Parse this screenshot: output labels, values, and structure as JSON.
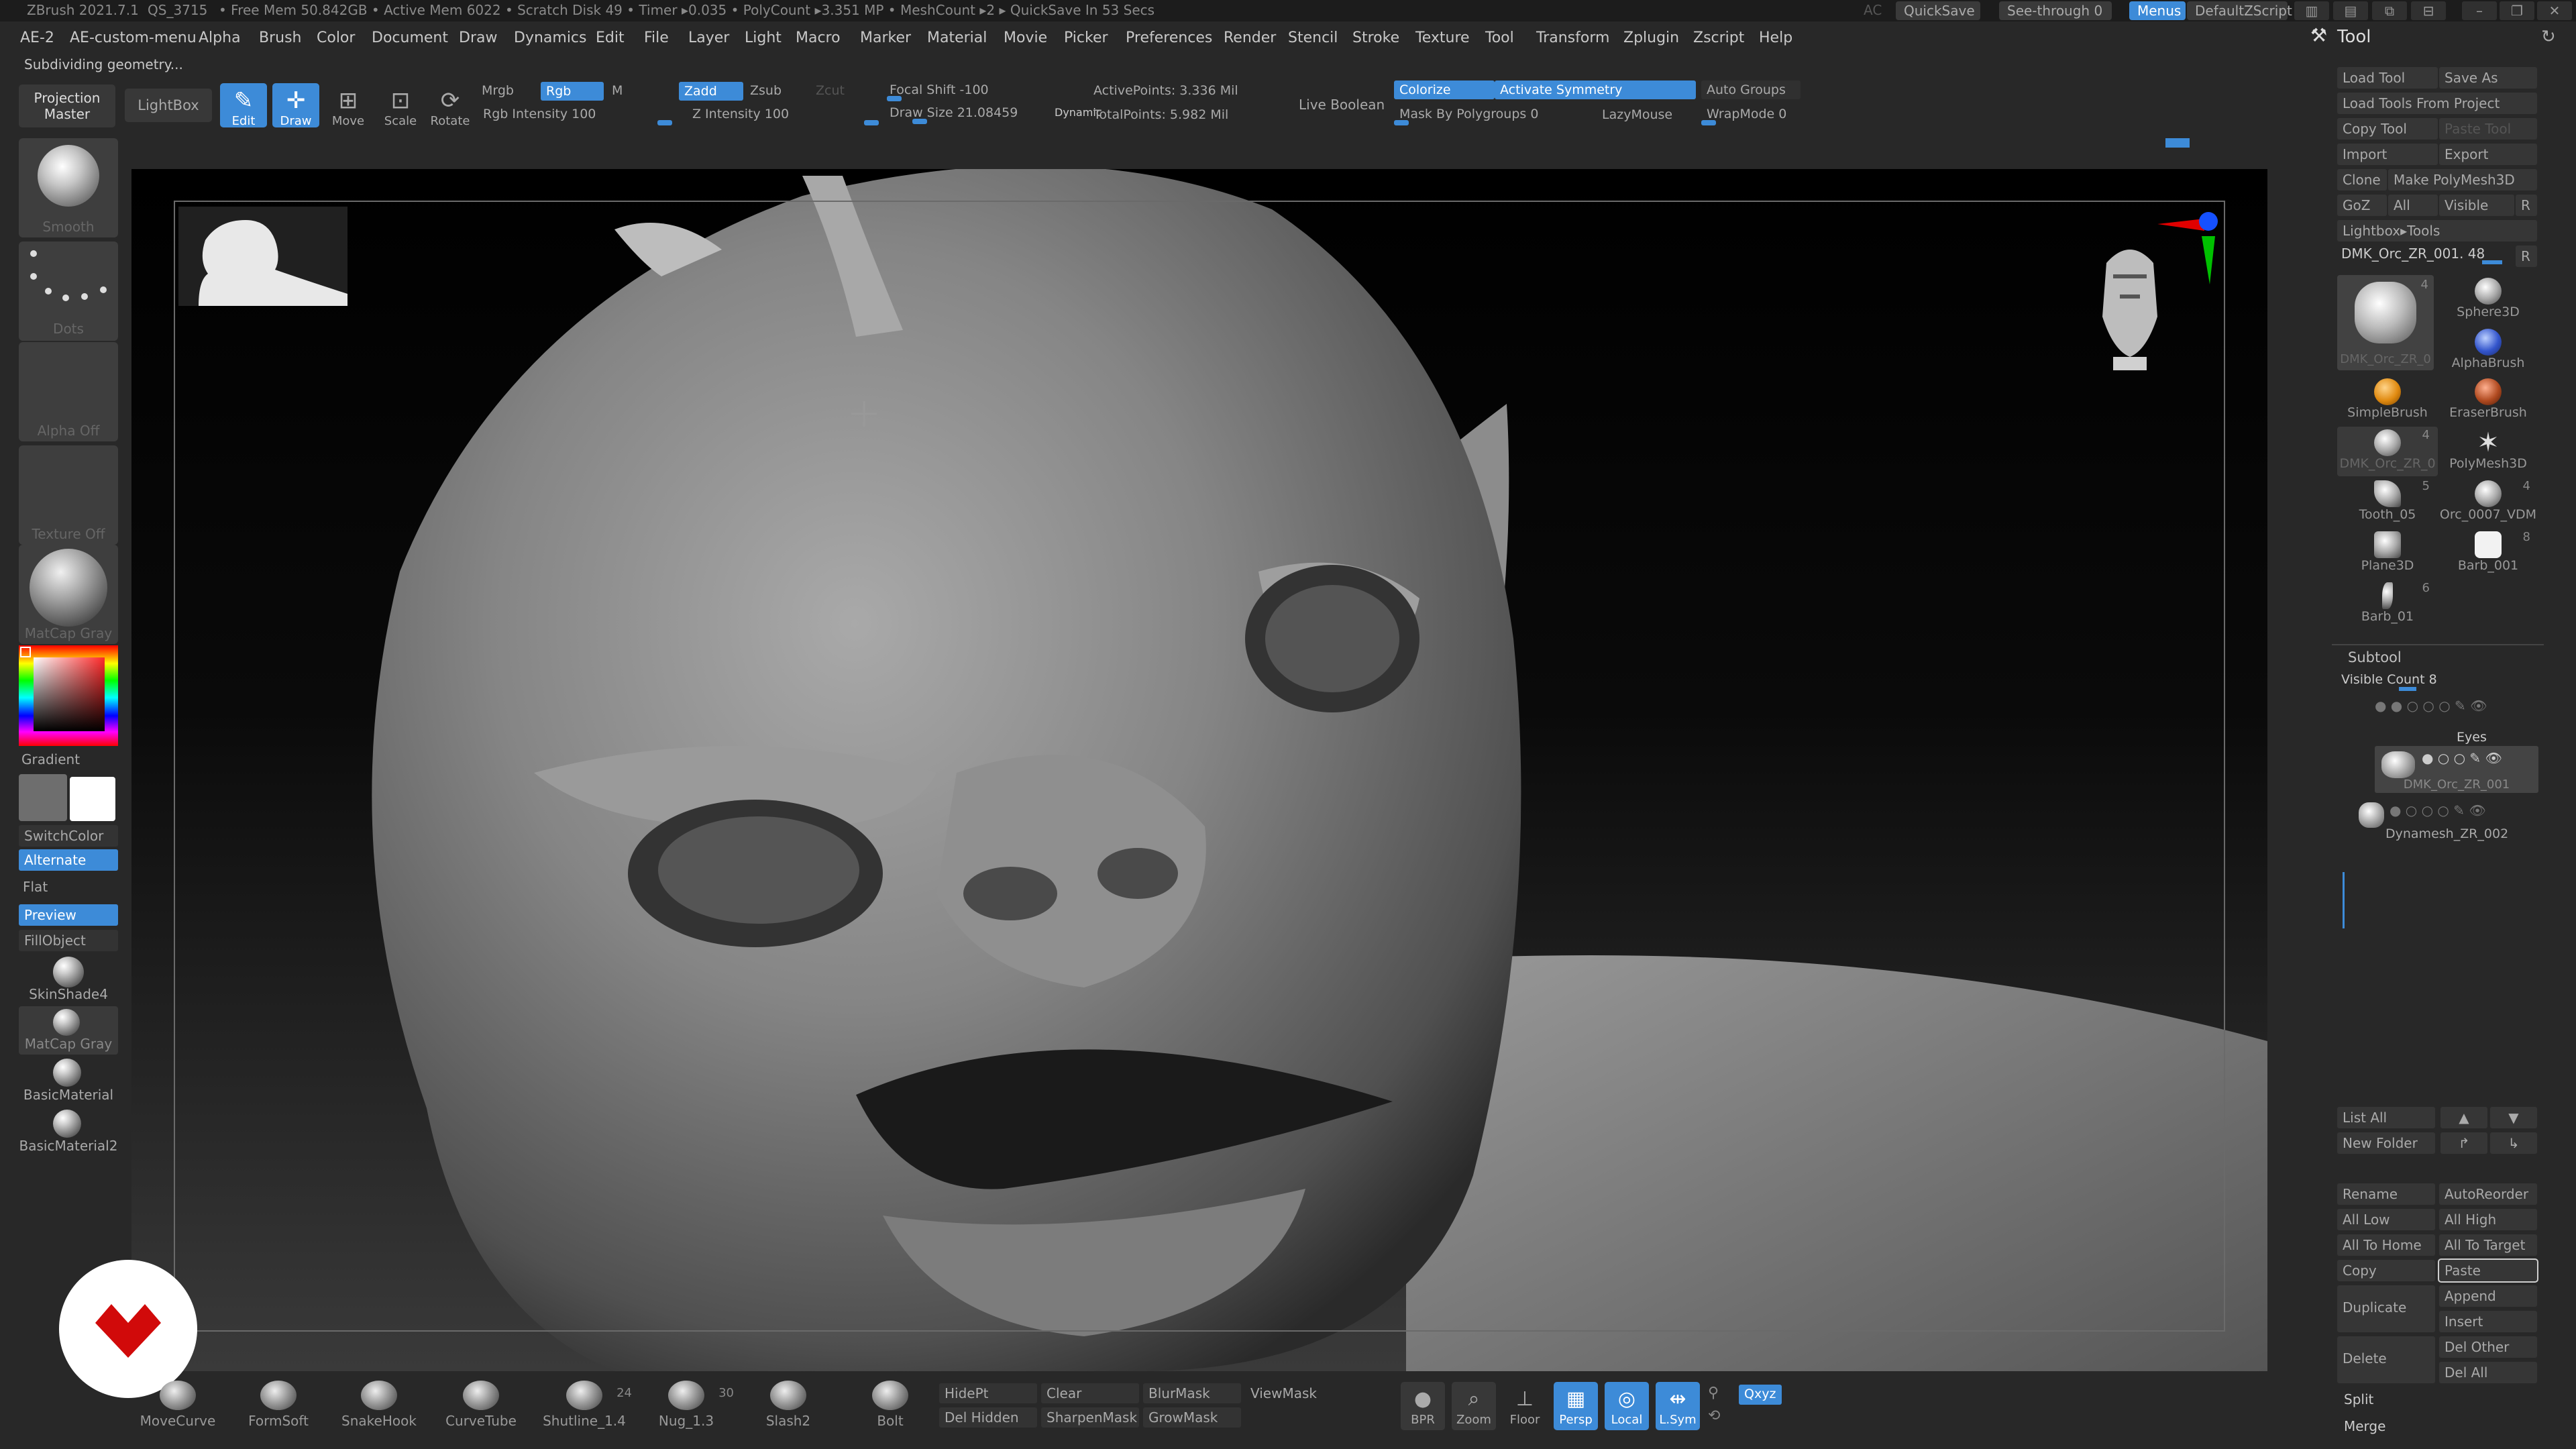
{
  "titlebar": {
    "app": "ZBrush 2021.7.1",
    "build": "QS_3715",
    "stats": "• Free Mem 50.842GB • Active Mem 6022 • Scratch Disk 49 • Timer ▸0.035 • PolyCount ▸3.351 MP • MeshCount ▸2  ▸ QuickSave In 53 Secs",
    "ac": "AC",
    "quicksave": "QuickSave",
    "seethrough": "See-through  0",
    "menus": "Menus",
    "zscript": "DefaultZScript"
  },
  "menubar": [
    "AE-2",
    "AE-custom-menu",
    "Alpha",
    "Brush",
    "Color",
    "Document",
    "Draw",
    "Dynamics",
    "Edit",
    "File",
    "Layer",
    "Light",
    "Macro",
    "Marker",
    "Material",
    "Movie",
    "Picker",
    "Preferences",
    "Render",
    "Stencil",
    "Stroke",
    "Texture",
    "Tool",
    "Transform",
    "Zplugin",
    "Zscript",
    "Help"
  ],
  "status": "Subdividing geometry...",
  "shelf": {
    "projection_master": "Projection Master",
    "lightbox": "LightBox",
    "edit": "Edit",
    "draw": "Draw",
    "move": "Move",
    "scale": "Scale",
    "rotate": "Rotate",
    "mrgb": "Mrgb",
    "rgb": "Rgb",
    "m": "M",
    "rgb_intensity": "Rgb Intensity 100",
    "zadd": "Zadd",
    "zsub": "Zsub",
    "zcut": "Zcut",
    "z_intensity": "Z Intensity 100",
    "focal_shift": "Focal Shift -100",
    "draw_size": "Draw Size 21.08459",
    "dynamic": "Dynamic",
    "active_points": "ActivePoints: 3.336 Mil",
    "total_points": "TotalPoints: 5.982 Mil",
    "live_boolean": "Live Boolean",
    "colorize": "Colorize",
    "activate_symmetry": "Activate Symmetry",
    "mask_by_polygroups": "Mask By Polygroups 0",
    "lazymouse": "LazyMouse",
    "auto_groups": "Auto Groups",
    "wrapmode": "WrapMode 0"
  },
  "lefttray": {
    "smooth": "Smooth",
    "dots": "Dots",
    "alpha_off": "Alpha Off",
    "texture_off": "Texture Off",
    "matcap_gray": "MatCap Gray",
    "gradient": "Gradient",
    "switchcolor": "SwitchColor",
    "alternate": "Alternate",
    "flat": "Flat",
    "preview": "Preview",
    "fillobject": "FillObject",
    "skinshade4": "SkinShade4",
    "matcap_gray2": "MatCap Gray",
    "basicmaterial": "BasicMaterial",
    "basicmaterial2": "BasicMaterial2"
  },
  "bottom": {
    "brushes": [
      {
        "name": "MoveCurve",
        "count": ""
      },
      {
        "name": "FormSoft",
        "count": ""
      },
      {
        "name": "SnakeHook",
        "count": ""
      },
      {
        "name": "CurveTube",
        "count": ""
      },
      {
        "name": "Shutline_1.4",
        "count": "24"
      },
      {
        "name": "Nug_1.3",
        "count": "30"
      },
      {
        "name": "Slash2",
        "count": ""
      },
      {
        "name": "Bolt",
        "count": ""
      }
    ],
    "hidept": "HidePt",
    "del_hidden": "Del Hidden",
    "clear": "Clear",
    "sharpenmask": "SharpenMask",
    "blurmask": "BlurMask",
    "growmask": "GrowMask",
    "viewmask": "ViewMask",
    "bpr": "BPR",
    "zoom": "Zoom",
    "floor": "Floor",
    "persp": "Persp",
    "local": "Local",
    "lsym": "L.Sym",
    "qxyz": "Qxyz"
  },
  "tool": {
    "title": "Tool",
    "load_tool": "Load Tool",
    "save_as": "Save As",
    "load_from_project": "Load Tools From Project",
    "copy_tool": "Copy Tool",
    "paste_tool": "Paste Tool",
    "import": "Import",
    "export": "Export",
    "clone": "Clone",
    "make_polymesh": "Make PolyMesh3D",
    "goz": "GoZ",
    "all": "All",
    "visible": "Visible",
    "r": "R",
    "lightbox_tools": "Lightbox▸Tools",
    "current": "DMK_Orc_ZR_001. 48",
    "tools": [
      {
        "name": "DMK_Orc_ZR_0",
        "count": "4"
      },
      {
        "name": "Sphere3D",
        "count": ""
      },
      {
        "name": "",
        "count": ""
      },
      {
        "name": "AlphaBrush",
        "count": ""
      },
      {
        "name": "SimpleBrush",
        "count": ""
      },
      {
        "name": "EraserBrush",
        "count": ""
      },
      {
        "name": "DMK_Orc_ZR_0",
        "count": "4"
      },
      {
        "name": "PolyMesh3D",
        "count": ""
      },
      {
        "name": "Tooth_05",
        "count": "5"
      },
      {
        "name": "Orc_0007_VDM",
        "count": "4"
      },
      {
        "name": "Plane3D",
        "count": ""
      },
      {
        "name": "Barb_001",
        "count": "8"
      },
      {
        "name": "Barb_01",
        "count": "6"
      }
    ]
  },
  "subtool": {
    "title": "Subtool",
    "visible_count": "Visible Count 8",
    "items": [
      "Eyes",
      "DMK_Orc_ZR_001",
      "Dynamesh_ZR_002"
    ],
    "list_all": "List All",
    "new_folder": "New Folder",
    "rename": "Rename",
    "autoreorder": "AutoReorder",
    "all_low": "All Low",
    "all_high": "All High",
    "all_to_home": "All To Home",
    "all_to_target": "All To Target",
    "copy": "Copy",
    "paste": "Paste",
    "append": "Append",
    "duplicate": "Duplicate",
    "insert": "Insert",
    "delete": "Delete",
    "del_other": "Del Other",
    "del_all": "Del All",
    "split": "Split",
    "merge": "Merge"
  }
}
